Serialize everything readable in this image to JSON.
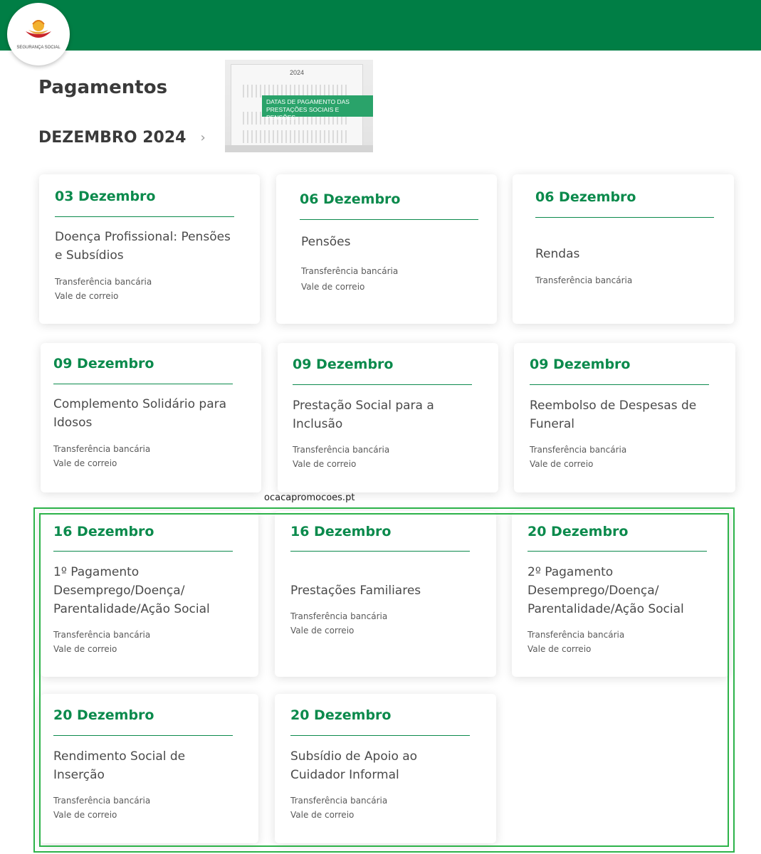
{
  "header": {
    "logo_text": "SEGURANÇA SOCIAL"
  },
  "page": {
    "title": "Pagamentos",
    "month": "DEZEMBRO 2024"
  },
  "banner": {
    "year": "2024",
    "line1": "DATAS DE PAGAMENTO DAS",
    "line2": "PRESTAÇÕES SOCIAIS E PENSÕES"
  },
  "watermark": "ocacapromocoes.pt",
  "cards": [
    {
      "date": "03 Dezembro",
      "title1": "Doença Profissional: Pensões",
      "title2": "e Subsídios",
      "m1": "Transferência bancária",
      "m2": "Vale de correio"
    },
    {
      "date": "06 Dezembro",
      "title1": "Pensões",
      "m1": "Transferência bancária",
      "m2": "Vale de correio"
    },
    {
      "date": "06 Dezembro",
      "title1": "Rendas",
      "m1": "Transferência bancária"
    },
    {
      "date": "09 Dezembro",
      "title1": "Complemento Solidário para",
      "title2": "Idosos",
      "m1": "Transferência bancária",
      "m2": "Vale de correio"
    },
    {
      "date": "09 Dezembro",
      "title1": "Prestação Social para a",
      "title2": "Inclusão",
      "m1": "Transferência bancária",
      "m2": "Vale de correio"
    },
    {
      "date": "09 Dezembro",
      "title1": "Reembolso de Despesas de",
      "title2": "Funeral",
      "m1": "Transferência bancária",
      "m2": "Vale de correio"
    },
    {
      "date": "16 Dezembro",
      "title1": "1º Pagamento",
      "title2": "Desemprego/Doença/",
      "title3": "Parentalidade/Ação Social",
      "m1": "Transferência bancária",
      "m2": "Vale de correio"
    },
    {
      "date": "16 Dezembro",
      "title1": "Prestações Familiares",
      "m1": "Transferência bancária",
      "m2": "Vale de correio"
    },
    {
      "date": "20 Dezembro",
      "title1": "2º Pagamento",
      "title2": "Desemprego/Doença/",
      "title3": "Parentalidade/Ação Social",
      "m1": "Transferência bancária",
      "m2": "Vale de correio"
    },
    {
      "date": "20 Dezembro",
      "title1": "Rendimento Social de",
      "title2": "Inserção",
      "m1": "Transferência bancária",
      "m2": "Vale de correio"
    },
    {
      "date": "20 Dezembro",
      "title1": "Subsídio de Apoio ao",
      "title2": "Cuidador Informal",
      "m1": "Transferência bancária",
      "m2": "Vale de correio"
    }
  ],
  "colors": {
    "brand_green": "#007e45",
    "date_green": "#0b8a4c",
    "highlight_green": "#2db34a"
  }
}
